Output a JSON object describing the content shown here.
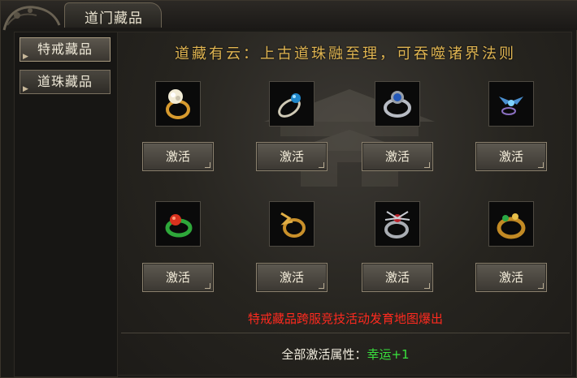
{
  "window": {
    "title": "道门藏品"
  },
  "sidebar": {
    "items": [
      {
        "label": "特戒藏品",
        "active": true
      },
      {
        "label": "道珠藏品",
        "active": false
      }
    ]
  },
  "main": {
    "motto": "道藏有云：上古道珠融至理，可吞噬诸界法则",
    "items": [
      {
        "icon": "diamond-ring-icon",
        "button": "激活"
      },
      {
        "icon": "blue-gem-ring-icon",
        "button": "激活"
      },
      {
        "icon": "sapphire-ring-icon",
        "button": "激活"
      },
      {
        "icon": "winged-gem-ring-icon",
        "button": "激活"
      },
      {
        "icon": "red-gem-green-ring-icon",
        "button": "激活"
      },
      {
        "icon": "gold-dragon-ring-icon",
        "button": "激活"
      },
      {
        "icon": "spider-ring-icon",
        "button": "激活"
      },
      {
        "icon": "gold-jade-ring-icon",
        "button": "激活"
      }
    ],
    "notice": "特戒藏品跨服竞技活动发育地图爆出",
    "footer": {
      "label": "全部激活属性：",
      "value": "幸运+1"
    }
  },
  "colors": {
    "accent_gold": "#e0b552",
    "notice_red": "#ff2a1f",
    "bonus_green": "#39e23d"
  }
}
